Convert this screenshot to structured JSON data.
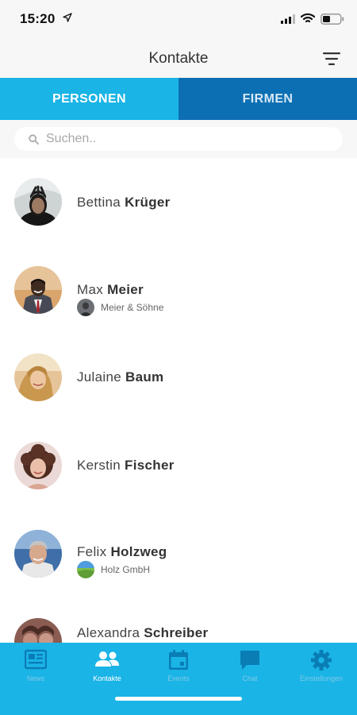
{
  "status_bar": {
    "time": "15:20"
  },
  "header": {
    "title": "Kontakte"
  },
  "tabs": [
    {
      "label": "PERSONEN"
    },
    {
      "label": "FIRMEN"
    }
  ],
  "search": {
    "placeholder": "Suchen.."
  },
  "contacts": [
    {
      "first": "Bettina",
      "last": "Krüger",
      "company": ""
    },
    {
      "first": "Max",
      "last": "Meier",
      "company": "Meier & Söhne"
    },
    {
      "first": "Julaine",
      "last": "Baum",
      "company": ""
    },
    {
      "first": "Kerstin",
      "last": "Fischer",
      "company": ""
    },
    {
      "first": "Felix",
      "last": "Holzweg",
      "company": "Holz GmbH"
    },
    {
      "first": "Alexandra",
      "last": "Schreiber",
      "company": ""
    }
  ],
  "tab_bar": [
    {
      "label": "News",
      "icon": "news-icon"
    },
    {
      "label": "Kontakte",
      "icon": "people-icon"
    },
    {
      "label": "Events",
      "icon": "calendar-icon"
    },
    {
      "label": "Chat",
      "icon": "chat-icon"
    },
    {
      "label": "Einstellungen",
      "icon": "gear-icon"
    }
  ],
  "colors": {
    "accent": "#1ab4e6",
    "tab_inactive": "#0d6fb3",
    "background": "#f7f7f7"
  }
}
